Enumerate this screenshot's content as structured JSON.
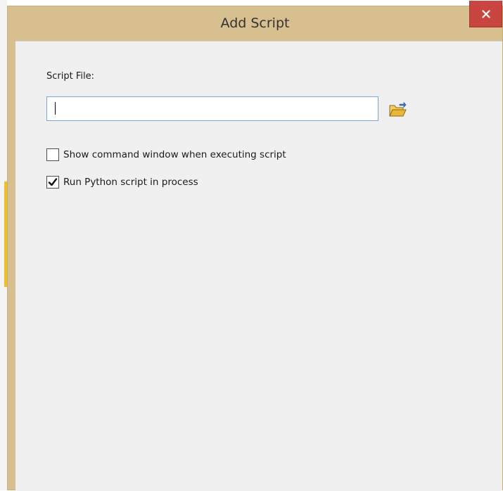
{
  "dialog": {
    "title": "Add Script",
    "close_icon": "close-icon"
  },
  "form": {
    "script_file_label": "Script File:",
    "script_file_value": "",
    "browse_icon": "open-folder-icon"
  },
  "options": [
    {
      "label": "Show command window when executing script",
      "checked": false
    },
    {
      "label": "Run Python script in process",
      "checked": true
    }
  ],
  "colors": {
    "title_bar": "#d8bf8f",
    "close_button": "#c9453f",
    "client_area": "#f0f0f0",
    "input_border": "#7aa7d6",
    "folder_icon": "#e8b83a"
  }
}
